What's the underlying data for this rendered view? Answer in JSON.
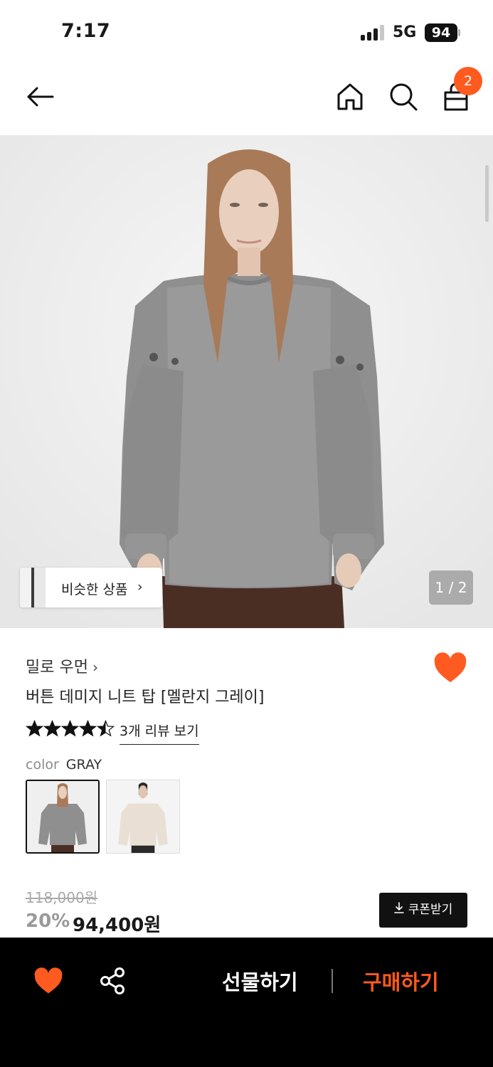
{
  "status_bar": {
    "time": "7:17",
    "network": "5G",
    "battery": "94"
  },
  "nav": {
    "back_icon": "arrow-left-icon",
    "home_icon": "home-icon",
    "search_icon": "search-icon",
    "bag_icon": "shopping-bag-icon",
    "bag_count": "2"
  },
  "hero": {
    "similar_label": "비슷한 상품",
    "similar_chevron": "›",
    "page_counter": "1 / 2"
  },
  "product": {
    "brand": "밀로 우먼",
    "brand_chevron": "›",
    "title": "버튼 데미지 니트 탑 [멜란지 그레이]",
    "rating": 4.5,
    "rating_max": 5,
    "review_link": "3개 리뷰 보기",
    "liked": true,
    "color_label": "color",
    "color_value": "GRAY",
    "color_options": [
      "GRAY",
      "BEIGE"
    ],
    "original_price": "118,000원",
    "discount": "20%",
    "sale_price": "94,400원",
    "coupon_label": "쿠폰받기"
  },
  "bottom_bar": {
    "gift_label": "선물하기",
    "buy_label": "구매하기"
  },
  "colors": {
    "accent": "#ff5a1f",
    "bar_bg": "#000000",
    "text": "#1a1a1a"
  }
}
